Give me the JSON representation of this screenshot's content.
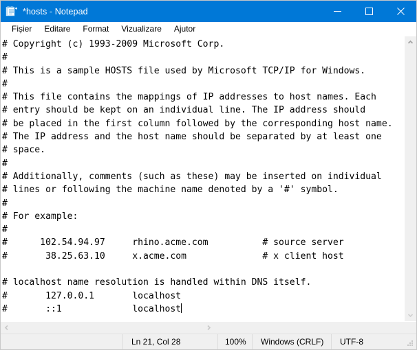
{
  "window": {
    "title": "*hosts - Notepad",
    "icon": "notepad-icon",
    "titlebar_color": "#0078d7",
    "controls": {
      "minimize": "minimize-icon",
      "maximize": "maximize-icon",
      "close": "close-icon"
    }
  },
  "menubar": {
    "items": [
      {
        "label": "Fișier"
      },
      {
        "label": "Editare"
      },
      {
        "label": "Format"
      },
      {
        "label": "Vizualizare"
      },
      {
        "label": "Ajutor"
      }
    ]
  },
  "editor": {
    "lines": [
      "# Copyright (c) 1993-2009 Microsoft Corp.",
      "#",
      "# This is a sample HOSTS file used by Microsoft TCP/IP for Windows.",
      "#",
      "# This file contains the mappings of IP addresses to host names. Each",
      "# entry should be kept on an individual line. The IP address should",
      "# be placed in the first column followed by the corresponding host name.",
      "# The IP address and the host name should be separated by at least one",
      "# space.",
      "#",
      "# Additionally, comments (such as these) may be inserted on individual",
      "# lines or following the machine name denoted by a '#' symbol.",
      "#",
      "# For example:",
      "#",
      "#      102.54.94.97     rhino.acme.com          # source server",
      "#       38.25.63.10     x.acme.com              # x client host",
      "",
      "# localhost name resolution is handled within DNS itself.",
      "#       127.0.0.1       localhost",
      "#       ::1             localhost"
    ],
    "caret_line": 20,
    "caret_visible": true
  },
  "scrollbars": {
    "vertical": {
      "up_arrow": "chevron-up-icon",
      "down_arrow": "chevron-down-icon"
    },
    "horizontal": {
      "left_arrow": "chevron-left-icon",
      "right_arrow": "chevron-right-icon"
    }
  },
  "statusbar": {
    "position": "Ln 21, Col 28",
    "zoom": "100%",
    "line_ending": "Windows (CRLF)",
    "encoding": "UTF-8",
    "grip": "resize-grip-icon"
  }
}
